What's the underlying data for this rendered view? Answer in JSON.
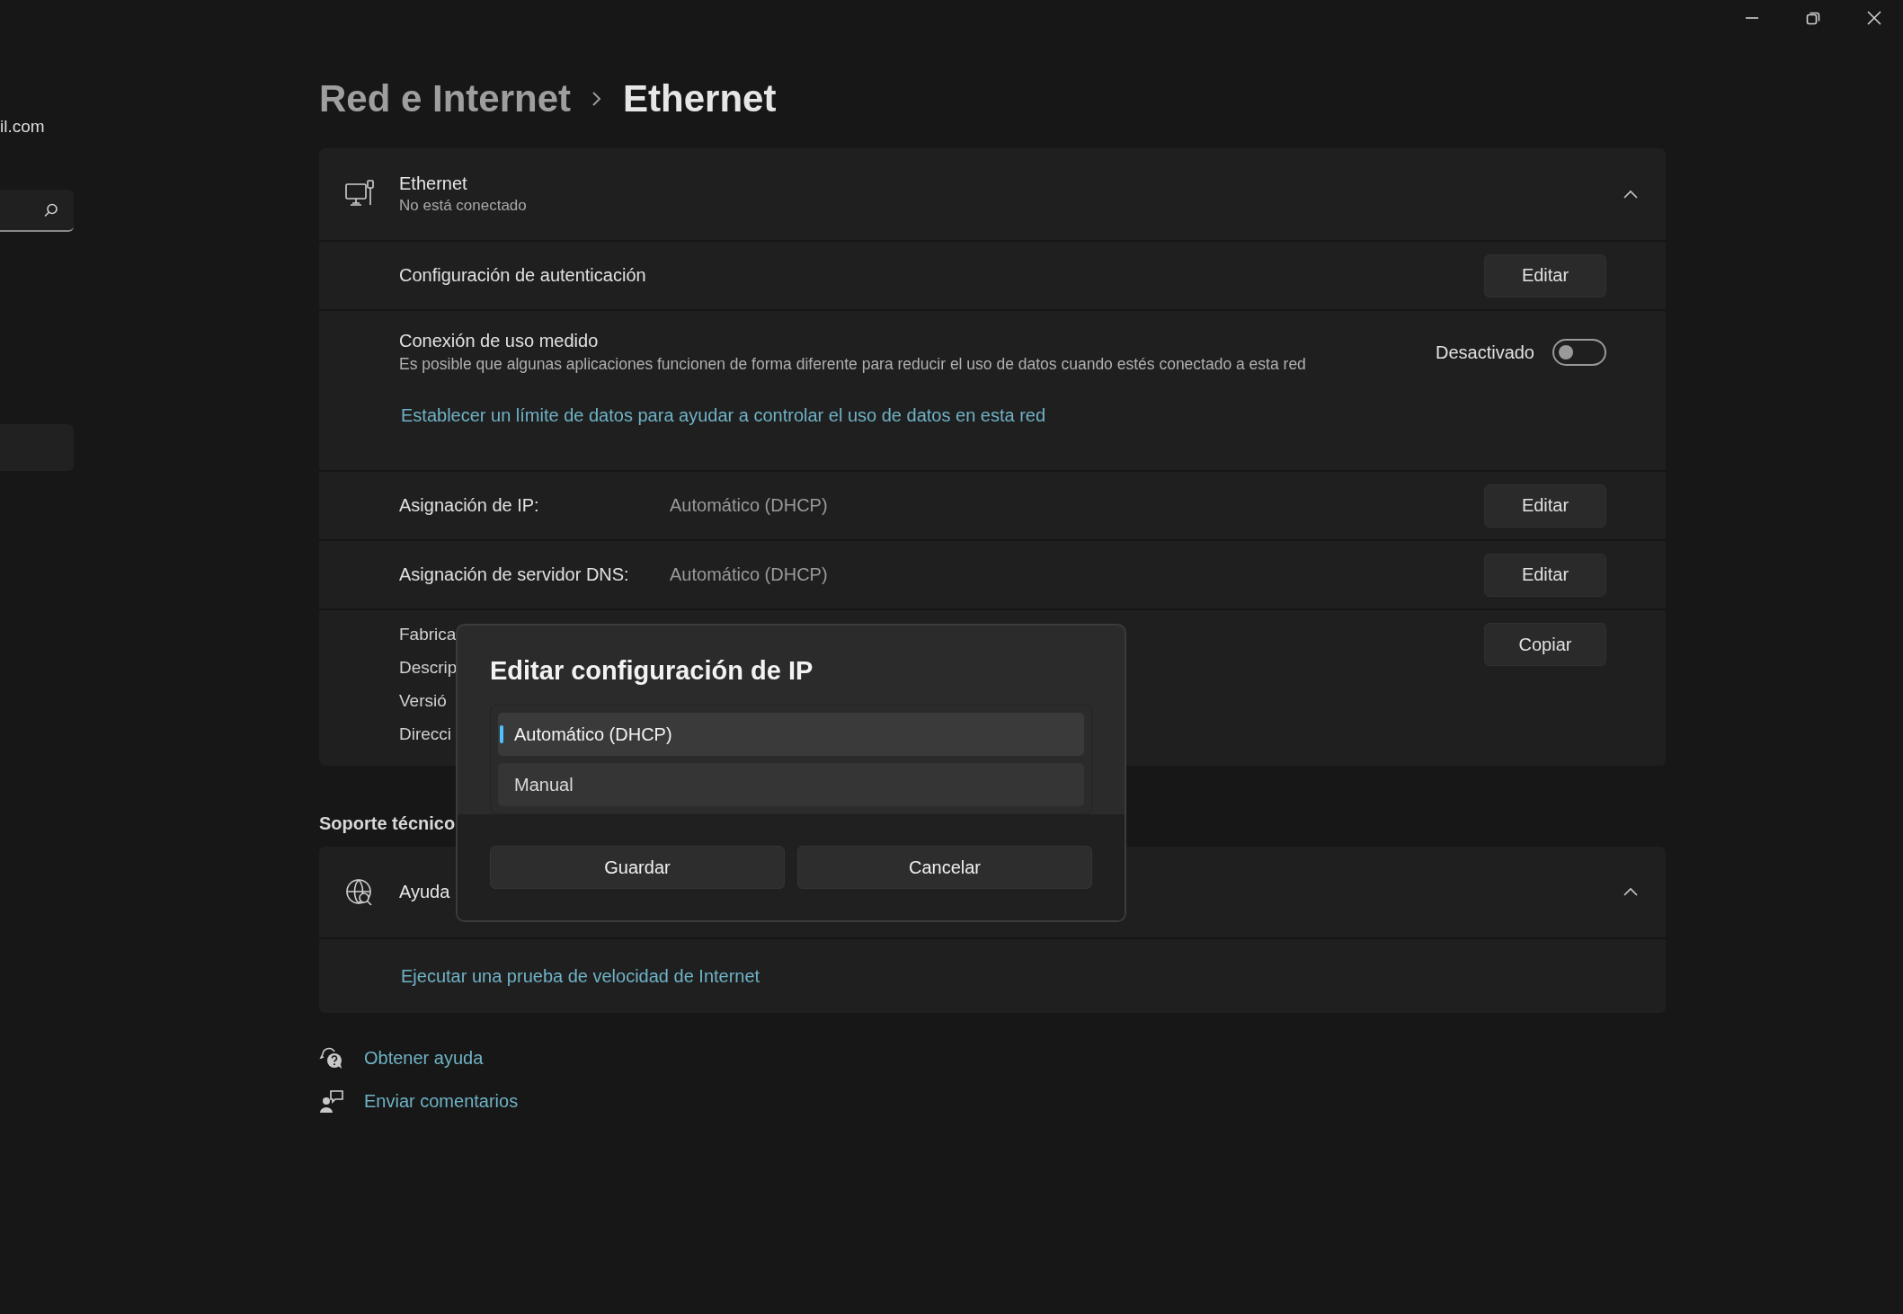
{
  "sidebar": {
    "email": "il.com"
  },
  "breadcrumb": [
    {
      "label": "Red e Internet",
      "current": false
    },
    {
      "label": "Ethernet",
      "current": true
    }
  ],
  "ethernet_card": {
    "title": "Ethernet",
    "status": "No está conectado",
    "expanded": true,
    "rows": [
      {
        "kind": "button",
        "label": "Configuración de autenticación",
        "button": "Editar"
      },
      {
        "kind": "toggle",
        "label": "Conexión de uso medido",
        "description": "Es posible que algunas aplicaciones funcionen de forma diferente para reducir el uso de datos cuando estés conectado a esta red",
        "toggle_label": "Desactivado",
        "on": false,
        "link": "Establecer un límite de datos para ayudar a controlar el uso de datos en esta red"
      },
      {
        "kind": "value",
        "label": "Asignación de IP:",
        "value": "Automático (DHCP)",
        "button": "Editar"
      },
      {
        "kind": "value",
        "label": "Asignación de servidor DNS:",
        "value": "Automático (DHCP)",
        "button": "Editar"
      },
      {
        "kind": "details",
        "labels": [
          "Fabrica",
          "Descrip",
          "Versió",
          "Direcci"
        ],
        "button": "Copiar"
      }
    ]
  },
  "support": {
    "heading": "Soporte técnico",
    "title": "Ayuda",
    "expanded": true,
    "link": "Ejecutar una prueba de velocidad de Internet"
  },
  "footer_links": [
    {
      "kind": "help",
      "label": "Obtener ayuda"
    },
    {
      "kind": "feedback",
      "label": "Enviar comentarios"
    }
  ],
  "dialog": {
    "title": "Editar configuración de IP",
    "options": [
      {
        "label": "Automático (DHCP)",
        "selected": true
      },
      {
        "label": "Manual",
        "selected": false
      }
    ],
    "buttons": [
      "Guardar",
      "Cancelar"
    ]
  }
}
